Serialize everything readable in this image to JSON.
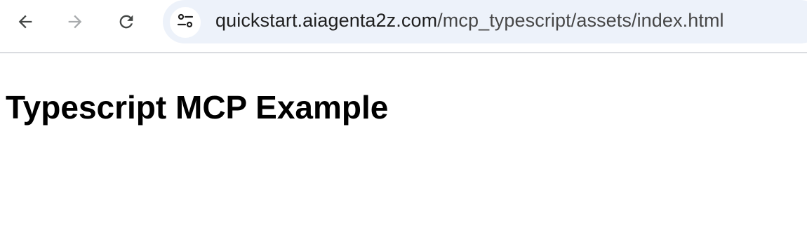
{
  "browser": {
    "back_icon": "arrow-left-icon",
    "forward_icon": "arrow-right-icon",
    "reload_icon": "reload-icon",
    "site_info_icon": "tune-icon",
    "url_host": "quickstart.aiagenta2z.com",
    "url_path": "/mcp_typescript/assets/index.html",
    "forward_enabled": false
  },
  "page": {
    "heading": "Typescript MCP Example"
  },
  "colors": {
    "omnibox_bg": "#edf2fa",
    "icon_active": "#444746",
    "icon_disabled": "#a8abad",
    "divider": "#dadce0"
  }
}
